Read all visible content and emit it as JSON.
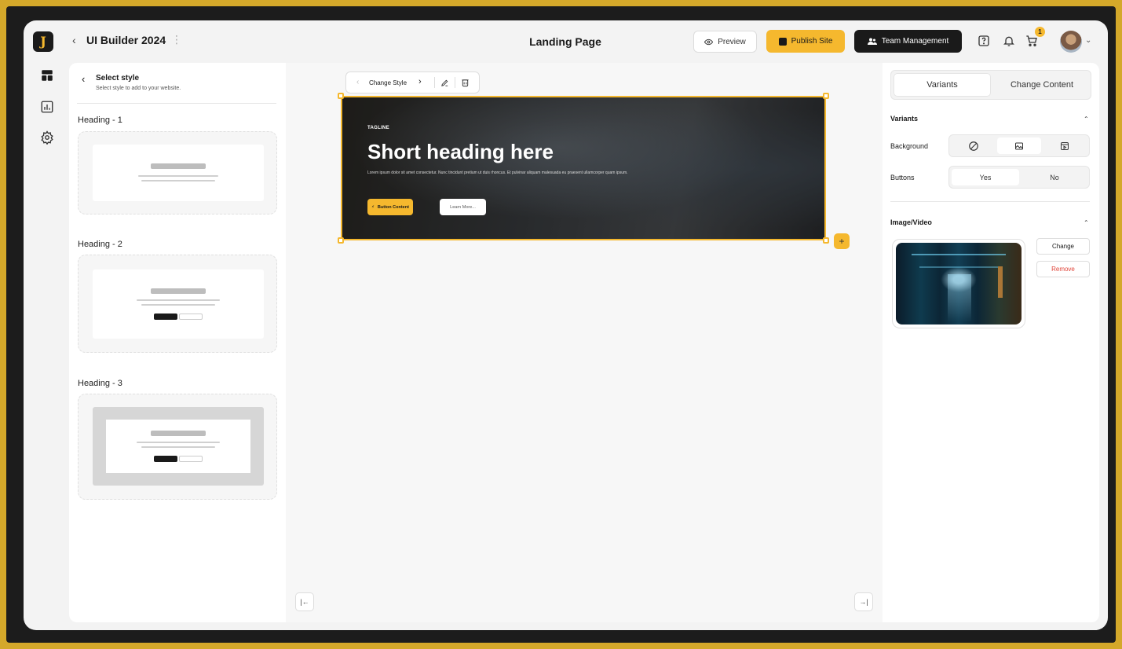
{
  "header": {
    "project_name": "UI Builder 2024",
    "page_name": "Landing Page",
    "preview_label": "Preview",
    "publish_label": "Publish Site",
    "team_label": "Team Management",
    "cart_count": "1"
  },
  "left_panel": {
    "title": "Select style",
    "subtitle": "Select style to add to your website.",
    "headings": [
      "Heading - 1",
      "Heading - 2",
      "Heading - 3"
    ]
  },
  "canvas": {
    "toolbar": {
      "change_style_label": "Change Style"
    },
    "hero": {
      "tagline": "TAGLINE",
      "heading": "Short heading here",
      "paragraph": "Lorem ipsum dolor sit amet consectetur. Nunc tincidunt pretium ut duis rhoncus. Et pulvinar aliquam malesuada eu praesent ullamcorper quam ipsum.",
      "primary_button": "Button Content",
      "secondary_button": "Learn More..."
    }
  },
  "right_panel": {
    "tabs": [
      "Variants",
      "Change Content"
    ],
    "variants_title": "Variants",
    "background_label": "Background",
    "buttons_label": "Buttons",
    "buttons_options": [
      "Yes",
      "No"
    ],
    "media_title": "Image/Video",
    "change_label": "Change",
    "remove_label": "Remove"
  },
  "colors": {
    "accent": "#f5b82e",
    "dark": "#1a1a1a",
    "danger": "#e0453a",
    "frame_border": "#d4a82a"
  }
}
